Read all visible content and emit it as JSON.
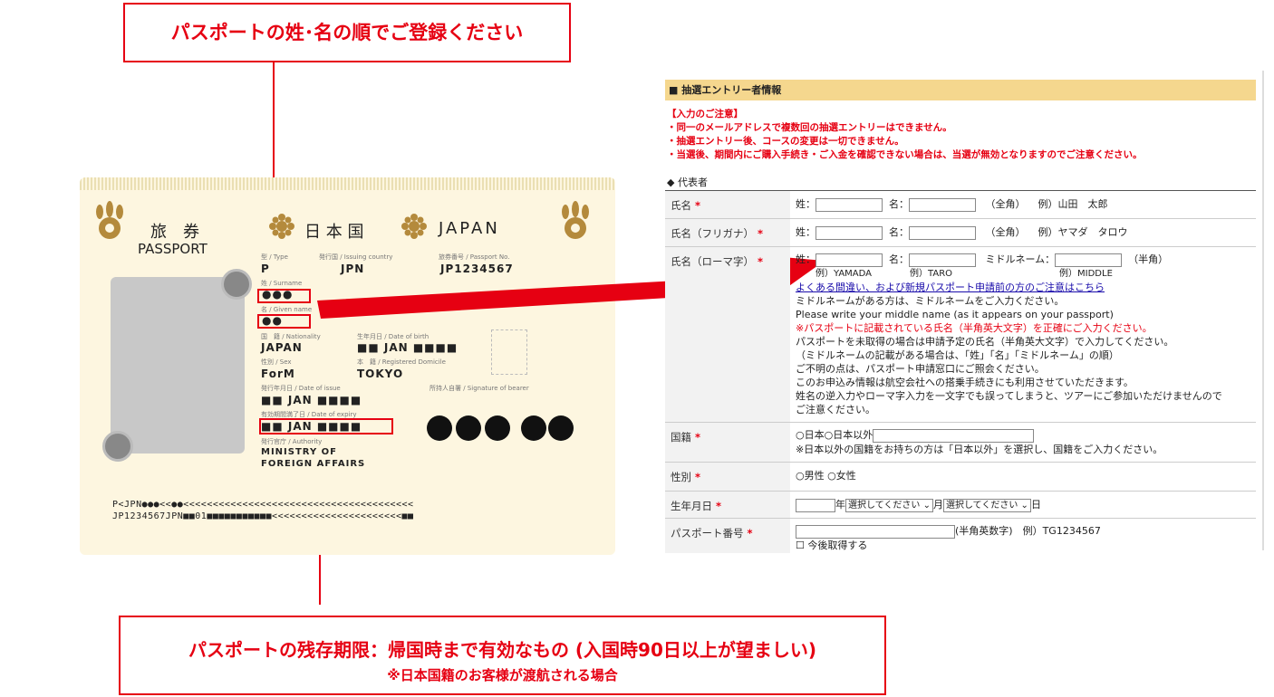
{
  "callouts": {
    "top": "パスポートの姓･名の順でご登録ください",
    "bottom_main": "パスポートの残存期限：帰国時まで有効なもの (入国時90日以上が望ましい)",
    "bottom_sub": "※日本国籍のお客様が渡航される場合"
  },
  "passport": {
    "title_jp": "旅　券",
    "title_en": "PASSPORT",
    "country_jp": "日 本 国",
    "country_en": "JAPAN",
    "type_label": "型 / Type",
    "type_value": "P",
    "issuing_label": "発行国 / Issuing country",
    "issuing_value": "JPN",
    "number_label": "旅券番号 / Passport No.",
    "number_value": "JP1234567",
    "surname_label": "姓 / Surname",
    "surname_value": "●●●",
    "given_label": "名 / Given name",
    "given_value": "●●",
    "nationality_label": "国　籍 / Nationality",
    "nationality_value": "JAPAN",
    "dob_label": "生年月日 / Date of birth",
    "dob_value": "■■ JAN ■■■■",
    "sex_label": "性別 / Sex",
    "sex_value": "ForM",
    "domicile_label": "本　籍 / Registered Domicile",
    "domicile_value": "TOKYO",
    "issue_label": "発行年月日 / Date of issue",
    "issue_value": "■■ JAN ■■■■",
    "signature_label": "所持人自署 / Signature of bearer",
    "expiry_label": "有効期間満了日 / Date of expiry",
    "expiry_value": "■■ JAN ■■■■",
    "authority_label": "発行官庁 / Authority",
    "authority_value1": "MINISTRY OF",
    "authority_value2": "FOREIGN AFFAIRS",
    "mrz1": "P<JPN●●●<<●●<<<<<<<<<<<<<<<<<<<<<<<<<<<<<<<<<<<<<<<",
    "mrz2": "JP1234567JPN■■01■■■■■■■■■■■<<<<<<<<<<<<<<<<<<<<<<■■"
  },
  "form": {
    "header": "■ 抽選エントリー者情報",
    "notice": [
      "【入力のご注意】",
      "・同一のメールアドレスで複数回の抽選エントリーはできません。",
      "・抽選エントリー後、コースの変更は一切できません。",
      "・当選後、期間内にご購入手続き・ご入金を確認できない場合は、当選が無効となりますのでご注意ください。"
    ],
    "section": "◆ 代表者",
    "name": {
      "label": "氏名",
      "sei": "姓：",
      "mei": "名：",
      "note": "（全角）",
      "example": "例）山田　太郎"
    },
    "kana": {
      "label": "氏名（フリガナ）",
      "sei": "姓：",
      "mei": "名：",
      "note": "（全角）",
      "example": "例）ヤマダ　タロウ"
    },
    "roman": {
      "label": "氏名（ローマ字）",
      "sei": "姓：",
      "mei": "名：",
      "middle": "ミドルネーム：",
      "half": "（半角）",
      "ex1": "例）YAMADA",
      "ex2": "例）TARO",
      "ex3": "例）MIDDLE",
      "link": "よくある間違い、および新規パスポート申請前の方のご注意はこちら",
      "lines": [
        "ミドルネームがある方は、ミドルネームをご入力ください。",
        "Please write your middle name (as it appears on your passport)"
      ],
      "red_line": "※パスポートに記載されている氏名（半角英大文字）を正確にご入力ください。",
      "lines2": [
        "パスポートを未取得の場合は申請予定の氏名（半角英大文字）で入力してください。",
        "（ミドルネームの記載がある場合は、「姓」「名」「ミドルネーム」の順）",
        "ご不明の点は、パスポート申請窓口にご照会ください。",
        "このお申込み情報は航空会社への搭乗手続きにも利用させていただきます。",
        "姓名の逆入力やローマ字入力を一文字でも誤ってしまうと、ツアーにご参加いただけませんので",
        "ご注意ください。"
      ]
    },
    "nationality": {
      "label": "国籍",
      "opt1": "○日本",
      "opt2": "○日本以外",
      "note": "※日本以外の国籍をお持ちの方は「日本以外」を選択し、国籍をご入力ください。"
    },
    "sex": {
      "label": "性別",
      "opt1": "○男性",
      "opt2": "○女性"
    },
    "dob": {
      "label": "生年月日",
      "year": "年",
      "month_placeholder": "選択してください",
      "month": "月",
      "day_placeholder": "選択してください",
      "day": "日"
    },
    "passport_no": {
      "label": "パスポート番号",
      "note": "(半角英数字)　例）TG1234567",
      "checkbox": "今後取得する"
    },
    "required_mark": "*"
  }
}
